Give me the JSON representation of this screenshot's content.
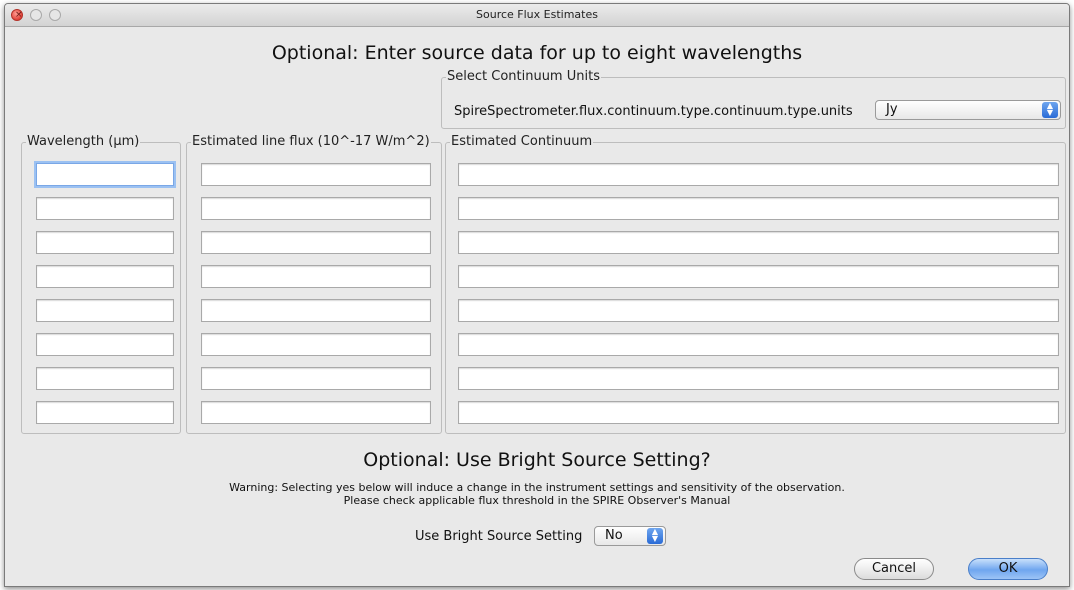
{
  "window": {
    "title": "Source Flux Estimates"
  },
  "heading": "Optional: Enter source data for up to eight wavelengths",
  "units": {
    "group_label": "Select Continuum Units",
    "label": "SpireSpectrometer.flux.continuum.type.continuum.type.units",
    "selected": "Jy"
  },
  "columns": {
    "wavelength": "Wavelength (µm)",
    "line_flux": "Estimated line flux (10^-17 W/m^2)",
    "continuum": "Estimated Continuum"
  },
  "rows": [
    {
      "wavelength": "",
      "line_flux": "",
      "continuum": ""
    },
    {
      "wavelength": "",
      "line_flux": "",
      "continuum": ""
    },
    {
      "wavelength": "",
      "line_flux": "",
      "continuum": ""
    },
    {
      "wavelength": "",
      "line_flux": "",
      "continuum": ""
    },
    {
      "wavelength": "",
      "line_flux": "",
      "continuum": ""
    },
    {
      "wavelength": "",
      "line_flux": "",
      "continuum": ""
    },
    {
      "wavelength": "",
      "line_flux": "",
      "continuum": ""
    },
    {
      "wavelength": "",
      "line_flux": "",
      "continuum": ""
    }
  ],
  "bright": {
    "heading": "Optional: Use Bright Source Setting?",
    "warning_line1": "Warning: Selecting yes below will induce a change in the instrument settings and sensitivity of the observation.",
    "warning_line2": "Please check applicable flux threshold in the SPIRE Observer's Manual",
    "label": "Use Bright Source Setting",
    "selected": "No"
  },
  "buttons": {
    "cancel": "Cancel",
    "ok": "OK"
  },
  "colors": {
    "focus_ring": "#9bc1f2",
    "default_button": "#6fa6ef",
    "close_button": "#e1433a"
  },
  "icons": {
    "close": "close-icon",
    "minimize": "minimize-icon",
    "zoom": "zoom-icon",
    "stepper": "up-down-arrows-icon"
  }
}
